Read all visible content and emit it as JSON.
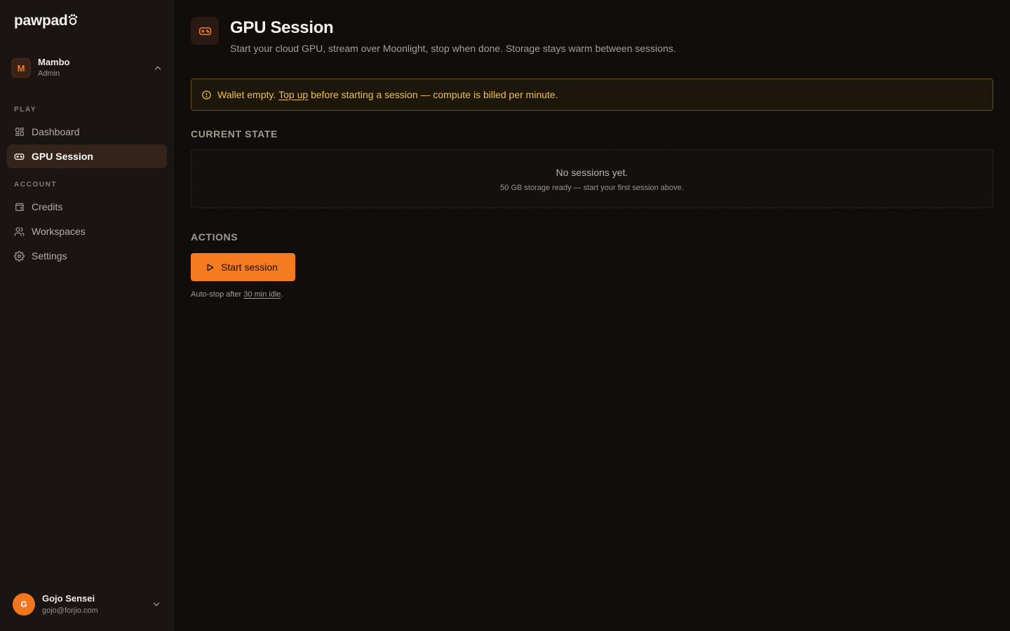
{
  "brand": {
    "name": "pawpad"
  },
  "workspace": {
    "initial": "M",
    "name": "Mambo",
    "role": "Admin"
  },
  "nav": {
    "sections": [
      {
        "label": "PLAY",
        "items": [
          {
            "label": "Dashboard",
            "icon": "dashboard-icon",
            "active": false
          },
          {
            "label": "GPU Session",
            "icon": "gamepad-icon",
            "active": true
          }
        ]
      },
      {
        "label": "ACCOUNT",
        "items": [
          {
            "label": "Credits",
            "icon": "wallet-icon",
            "active": false
          },
          {
            "label": "Workspaces",
            "icon": "users-icon",
            "active": false
          },
          {
            "label": "Settings",
            "icon": "gear-icon",
            "active": false
          }
        ]
      }
    ]
  },
  "user": {
    "initial": "G",
    "name": "Gojo Sensei",
    "email": "gojo@forjio.com"
  },
  "page": {
    "title": "GPU Session",
    "subtitle": "Start your cloud GPU, stream over Moonlight, stop when done. Storage stays warm between sessions."
  },
  "alert": {
    "prefix": "Wallet empty.",
    "link": "Top up",
    "suffix": "before starting a session — compute is billed per minute."
  },
  "current_state": {
    "label": "CURRENT STATE",
    "empty_title": "No sessions yet.",
    "empty_sub": "50 GB storage ready — start your first session above."
  },
  "actions": {
    "label": "ACTIONS",
    "start_label": "Start session",
    "auto_stop_prefix": "Auto-stop after",
    "auto_stop_link": "30 min idle",
    "auto_stop_suffix": "."
  },
  "colors": {
    "accent": "#f57b20",
    "warning": "#f2c04a",
    "background": "#110d0b",
    "sidebar": "#1a1512"
  }
}
